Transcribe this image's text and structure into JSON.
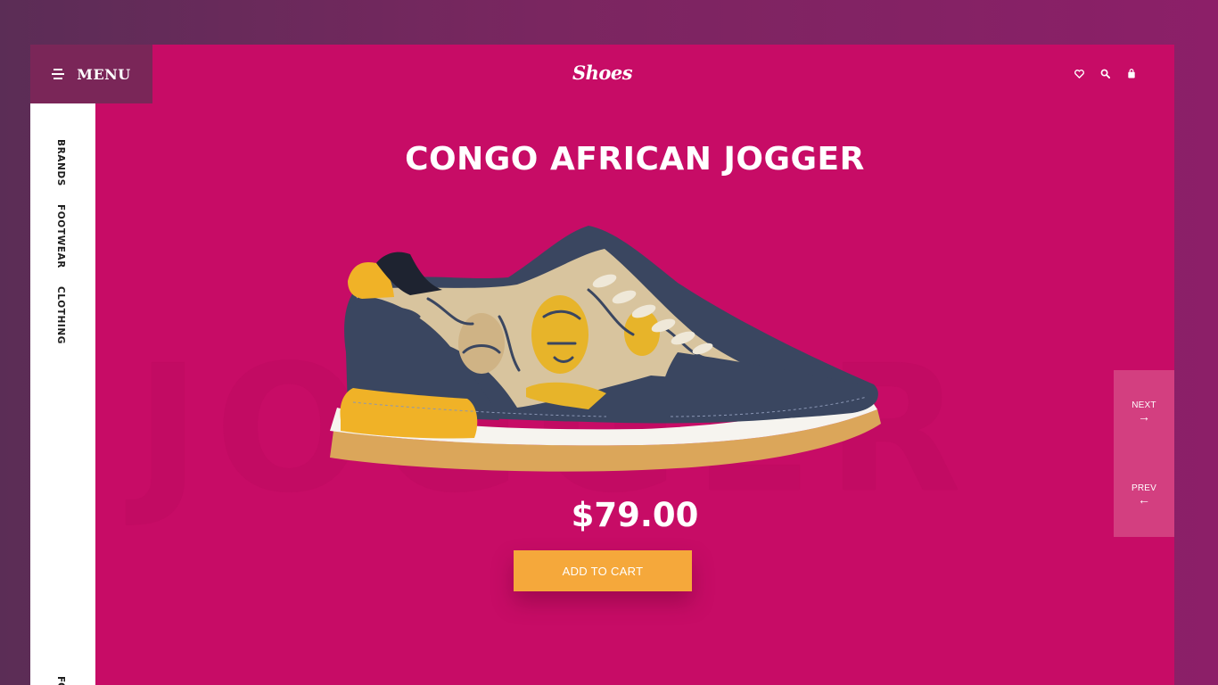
{
  "header": {
    "menu_label": "MENU",
    "logo": "Shoes",
    "icons": [
      "heart-icon",
      "search-icon",
      "bag-icon"
    ]
  },
  "sidebar": {
    "items": [
      {
        "label": "BRANDS"
      },
      {
        "label": "FOOTWEAR"
      },
      {
        "label": "CLOTHING"
      }
    ],
    "bottom_label": "FO"
  },
  "product": {
    "title": "CONGO AFRICAN JOGGER",
    "background_word": "JOGGER",
    "price": "$79.00",
    "cta": "ADD TO CART"
  },
  "pager": {
    "next_label": "NEXT",
    "next_arrow": "→",
    "prev_label": "PREV",
    "prev_arrow": "←"
  },
  "colors": {
    "page_bg": "#c70c66",
    "menu_bg": "#7a2658",
    "cta_bg": "#f5a83b",
    "pager_bg": "#d33f80"
  }
}
